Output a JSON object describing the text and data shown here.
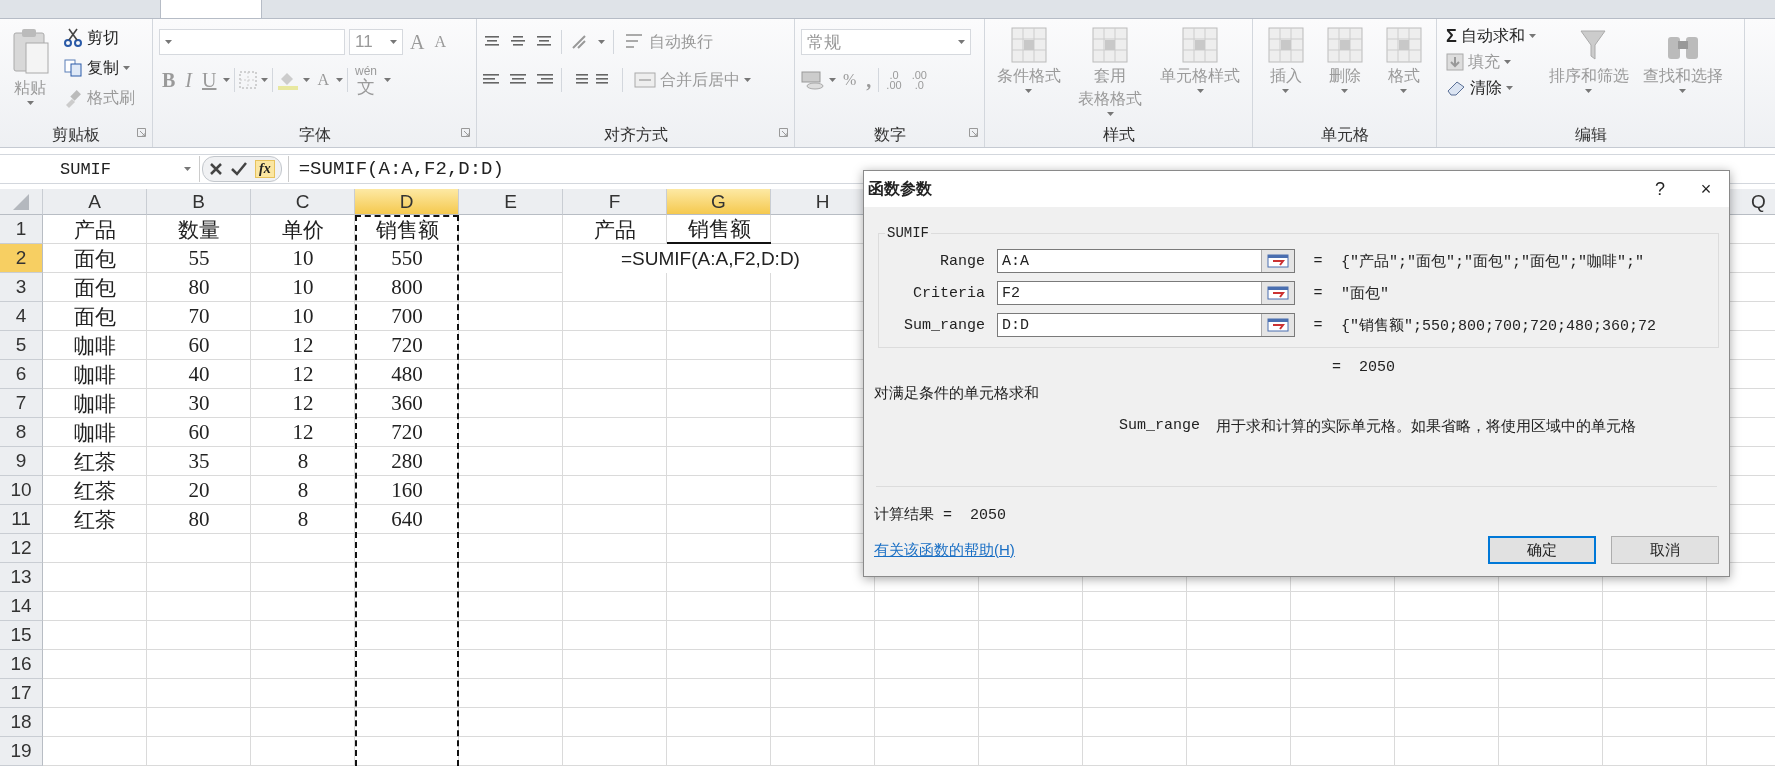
{
  "ribbon": {
    "groups": [
      {
        "kind": "clipboard",
        "label": "剪贴板",
        "paste": {
          "label": "粘贴",
          "disabled": true
        },
        "buttons": [
          {
            "label": "剪切",
            "disabled": false,
            "menu": false
          },
          {
            "label": "复制",
            "disabled": false,
            "menu": true
          },
          {
            "label": "格式刷",
            "disabled": true,
            "menu": false
          }
        ]
      },
      {
        "kind": "font",
        "label": "字体",
        "disabled": true,
        "font_size": "11",
        "grow": "A",
        "shrink": "A",
        "bold": "B",
        "italic": "I",
        "underline": "U",
        "font_color": "A",
        "phonetic": [
          "wén",
          "文"
        ]
      },
      {
        "kind": "alignment",
        "label": "对齐方式",
        "disabled": true,
        "wrap": "自动换行",
        "merge": "合并后居中"
      },
      {
        "kind": "number",
        "label": "数字",
        "disabled": true,
        "format": "常规",
        "percent": "%",
        "comma": ",",
        "increase_decimal": [
          ".0",
          ".00"
        ],
        "decrease_decimal": [
          ".00",
          ".0"
        ]
      },
      {
        "kind": "large",
        "label": "样式",
        "buttons": [
          {
            "lines": [
              "条件格式"
            ],
            "disabled": true
          },
          {
            "lines": [
              "套用",
              "表格格式"
            ],
            "disabled": true
          },
          {
            "lines": [
              "单元格样式"
            ],
            "disabled": true
          }
        ]
      },
      {
        "kind": "large",
        "label": "单元格",
        "buttons": [
          {
            "lines": [
              "插入"
            ],
            "disabled": true
          },
          {
            "lines": [
              "删除"
            ],
            "disabled": true
          },
          {
            "lines": [
              "格式"
            ],
            "disabled": true
          }
        ]
      },
      {
        "kind": "editing",
        "label": "编辑",
        "small": [
          {
            "symbol": "Σ",
            "label": "自动求和",
            "disabled": false
          },
          {
            "label": "填充",
            "disabled": true
          },
          {
            "label": "清除",
            "disabled": false
          }
        ],
        "buttons": [
          {
            "lines": [
              "排序和筛选"
            ],
            "disabled": true
          },
          {
            "lines": [
              "查找和选择"
            ],
            "disabled": true
          }
        ]
      }
    ]
  },
  "formula_bar": {
    "name_box": "SUMIF",
    "fx_label": "fx",
    "formula": "=SUMIF(A:A,F2,D:D)"
  },
  "sheet": {
    "columns": [
      {
        "label": "A",
        "selected": false,
        "marquee": false
      },
      {
        "label": "B",
        "selected": false,
        "marquee": false
      },
      {
        "label": "C",
        "selected": false,
        "marquee": false
      },
      {
        "label": "D",
        "selected": true,
        "marquee": true
      },
      {
        "label": "E",
        "selected": false,
        "marquee": false
      },
      {
        "label": "F",
        "selected": false,
        "marquee": false
      },
      {
        "label": "G",
        "selected": true,
        "marquee": false
      },
      {
        "label": "H",
        "selected": false,
        "marquee": false
      }
    ],
    "right_columns": [
      {
        "label": "Q",
        "selected": false
      }
    ],
    "rows": [
      {
        "number": "1",
        "selected": false,
        "cells": [
          "产品",
          "数量",
          "单价",
          "销售额"
        ]
      },
      {
        "number": "2",
        "selected": true,
        "cells": [
          "面包",
          "55",
          "10",
          "550"
        ]
      },
      {
        "number": "3",
        "selected": false,
        "cells": [
          "面包",
          "80",
          "10",
          "800"
        ]
      },
      {
        "number": "4",
        "selected": false,
        "cells": [
          "面包",
          "70",
          "10",
          "700"
        ]
      },
      {
        "number": "5",
        "selected": false,
        "cells": [
          "咖啡",
          "60",
          "12",
          "720"
        ]
      },
      {
        "number": "6",
        "selected": false,
        "cells": [
          "咖啡",
          "40",
          "12",
          "480"
        ]
      },
      {
        "number": "7",
        "selected": false,
        "cells": [
          "咖啡",
          "30",
          "12",
          "360"
        ]
      },
      {
        "number": "8",
        "selected": false,
        "cells": [
          "咖啡",
          "60",
          "12",
          "720"
        ]
      },
      {
        "number": "9",
        "selected": false,
        "cells": [
          "红茶",
          "35",
          "8",
          "280"
        ]
      },
      {
        "number": "10",
        "selected": false,
        "cells": [
          "红茶",
          "20",
          "8",
          "160"
        ]
      },
      {
        "number": "11",
        "selected": false,
        "cells": [
          "红茶",
          "80",
          "8",
          "640"
        ]
      },
      {
        "number": "12",
        "selected": false
      },
      {
        "number": "13",
        "selected": false
      },
      {
        "number": "14",
        "selected": false
      },
      {
        "number": "15",
        "selected": false
      },
      {
        "number": "16",
        "selected": false
      },
      {
        "number": "17",
        "selected": false
      },
      {
        "number": "18",
        "selected": false
      },
      {
        "number": "19",
        "selected": false
      }
    ],
    "criteria": {
      "headers": [
        "产品",
        "销售额"
      ],
      "formula": "=SUMIF(A:A,F2,D:D)"
    }
  },
  "dialog": {
    "title": "函数参数",
    "help_button": "?",
    "close_button": "×",
    "function": "SUMIF",
    "args": [
      {
        "label": "Range",
        "value": "A:A",
        "sign": "=",
        "result": "{\"产品\";\"面包\";\"面包\";\"面包\";\"咖啡\";\""
      },
      {
        "label": "Criteria",
        "value": "F2",
        "sign": "=",
        "result": "\"面包\""
      },
      {
        "label": "Sum_range",
        "value": "D:D",
        "sign": "=",
        "result": "{\"销售额\";550;800;700;720;480;360;72"
      }
    ],
    "total": {
      "sign": "=",
      "value": "2050"
    },
    "description": "对满足条件的单元格求和",
    "arg_help": {
      "name": "Sum_range",
      "text": "用于求和计算的实际单元格。如果省略，将使用区域中的单元格"
    },
    "result": "计算结果 =  2050",
    "help_link": "有关该函数的帮助(H)",
    "buttons": [
      {
        "label": "确定",
        "default": true
      },
      {
        "label": "取消",
        "default": false
      }
    ]
  }
}
